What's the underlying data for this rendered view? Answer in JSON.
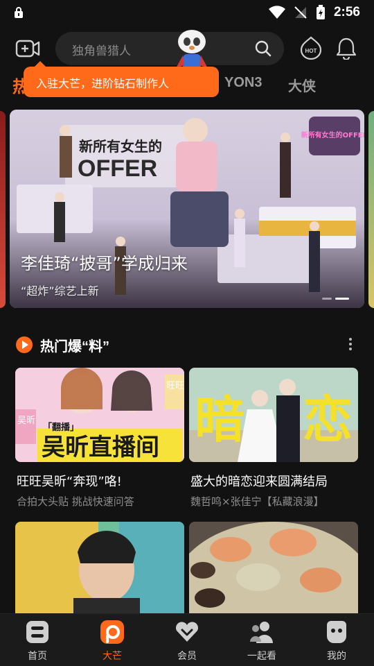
{
  "status_bar": {
    "time": "2:56"
  },
  "top_bar": {
    "search_placeholder": "独角兽猎人",
    "hot_label": "HOT"
  },
  "tabs": [
    {
      "label": "热",
      "active": true
    },
    {
      "label": "YON3",
      "active": false
    },
    {
      "label": "大侠",
      "active": false
    }
  ],
  "tooltip": {
    "text": "入驻大芒，进阶钻石制作人"
  },
  "hero": {
    "title": "李佳琦“披哥”学成归来",
    "subtitle": "“超炸”综艺上新",
    "poster_text": "新所有女生的",
    "poster_offer": "OFFER",
    "logo_text": "新所有女生的OFFER"
  },
  "section": {
    "title": "热门爆“料”"
  },
  "cards": [
    {
      "title": "旺旺吴昕“奔现”咯!",
      "subtitle": "合拍大头贴 挑战快速问答",
      "thumb_text": "吴昕直播间",
      "thumb_tag": "「翻播」",
      "side_left": "吴昕",
      "side_right": "旺旺"
    },
    {
      "title": "盛大的暗恋迎来圆满结局",
      "subtitle": "魏哲鸣×张佳宁【私藏浪漫】",
      "thumb_text_left": "暗",
      "thumb_text_right": "恋"
    },
    {
      "title": "",
      "subtitle": ""
    },
    {
      "title": "",
      "subtitle": ""
    }
  ],
  "bottom_nav": [
    {
      "label": "首页",
      "icon": "home-icon",
      "active": false
    },
    {
      "label": "大芒",
      "icon": "mango-icon",
      "active": true
    },
    {
      "label": "会员",
      "icon": "vip-icon",
      "active": false
    },
    {
      "label": "一起看",
      "icon": "watch-together-icon",
      "active": false
    },
    {
      "label": "我的",
      "icon": "profile-icon",
      "active": false
    }
  ],
  "colors": {
    "accent": "#ff6a1a",
    "background": "#121212",
    "nav_bg": "#1b1b1b"
  }
}
